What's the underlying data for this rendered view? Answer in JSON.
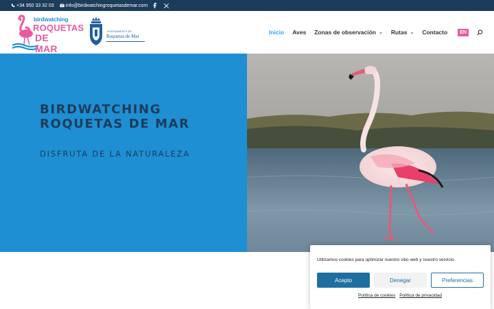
{
  "topbar": {
    "phone": "+34 950 33 32 03",
    "email": "info@birdwatchingroquetasdemar.com",
    "social": [
      "facebook-icon",
      "x-icon"
    ]
  },
  "logo": {
    "line1": "birdwatching",
    "line2": "ROQUETAS",
    "line3": "DE MAR"
  },
  "council_logo": {
    "small": "AYUNTAMIENTO DE",
    "name": "Roquetas de Mar"
  },
  "nav": {
    "items": [
      {
        "label": "Inicio",
        "active": true
      },
      {
        "label": "Aves"
      },
      {
        "label": "Zonas de observación",
        "dropdown": true
      },
      {
        "label": "Rutas",
        "dropdown": true
      },
      {
        "label": "Contacto"
      }
    ],
    "lang": "EN",
    "search_icon": "search-icon"
  },
  "hero": {
    "title_line1": "BIRDWATCHING",
    "title_line2": "ROQUETAS DE MAR",
    "subtitle": "DISFRUTA DE LA NATURALEZA",
    "image": "flamingo-photo",
    "bg_color": "#1e8fd3"
  },
  "cookie": {
    "message": "Utilizamos cookies para optimizar nuestro sitio web y nuestro servicio.",
    "accept": "Acepto",
    "deny": "Denegar",
    "preferences": "Preferencias",
    "cookie_policy": "Política de cookies",
    "privacy_policy": "Política de privacidad"
  },
  "colors": {
    "topbar": "#1c3c5b",
    "accent": "#2ea3f2",
    "pink": "#e95a9d",
    "button": "#1e6fa0"
  }
}
